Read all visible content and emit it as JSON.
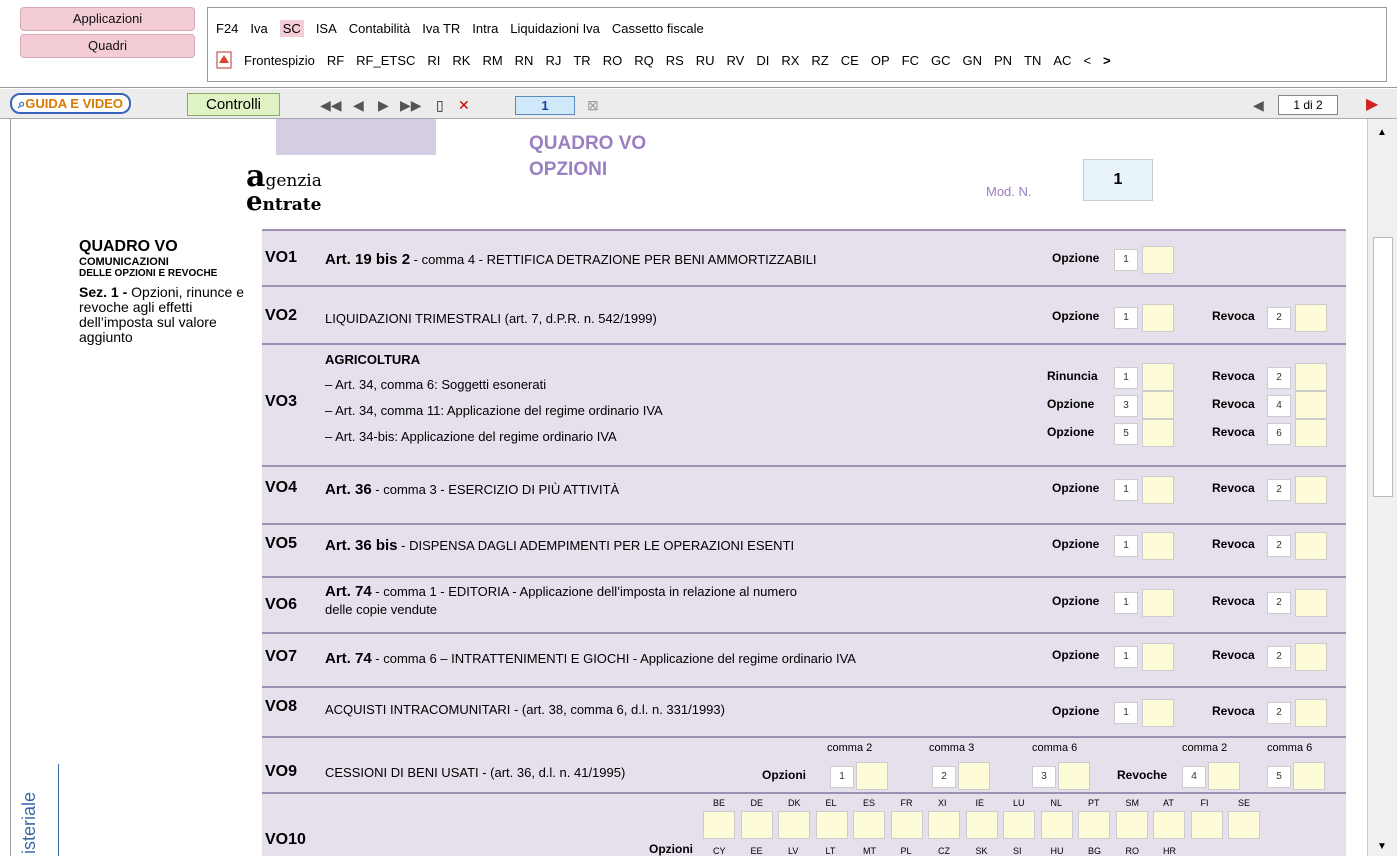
{
  "apps": {
    "applicazioni": "Applicazioni",
    "quadri": "Quadri"
  },
  "nav1": [
    "F24",
    "Iva",
    "SC",
    "ISA",
    "Contabilità",
    "Iva TR",
    "Intra",
    "Liquidazioni Iva",
    "Cassetto fiscale"
  ],
  "nav2": [
    "Frontespizio",
    "RF",
    "RF_ETSC",
    "RI",
    "RK",
    "RM",
    "RN",
    "RJ",
    "TR",
    "RO",
    "RQ",
    "RS",
    "RU",
    "RV",
    "DI",
    "RX",
    "RZ",
    "CE",
    "OP",
    "FC",
    "GC",
    "GN",
    "PN",
    "TN",
    "AC"
  ],
  "nav2_prev": "<",
  "nav2_next": ">",
  "toolbar": {
    "guida": "GUIDA E VIDEO",
    "controlli": "Controlli",
    "page": "1",
    "pagecount": "1 di 2"
  },
  "header": {
    "logo1": "genzia",
    "logo2": "ntrate",
    "title1": "QUADRO VO",
    "title2": "OPZIONI",
    "modn": "Mod. N.",
    "modval": "1"
  },
  "side": {
    "t1": "QUADRO VO",
    "t2": "Comunicazioni",
    "t3": "delle opzioni e revoche",
    "t4": "Sez. 1 -",
    "t5": "Opzioni, rinunce e revoche agli effetti dell’imposta sul valore aggiunto",
    "vert": "isteriale"
  },
  "rows": {
    "vo1": {
      "code": "VO1",
      "bold": "Art. 19 bis 2",
      "desc": " - comma 4 - RETTIFICA DETRAZIONE PER BENI AMMORTIZZABILI"
    },
    "vo2": {
      "code": "VO2",
      "desc": "LIQUIDAZIONI TRIMESTRALI  (art. 7, d.P.R. n. 542/1999)"
    },
    "vo3": {
      "code": "VO3",
      "head": "AGRICOLTURA",
      "l1": "– Art. 34, comma  6: Soggetti esonerati",
      "l2": "– Art. 34, comma 11: Applicazione del regime ordinario IVA",
      "l3": "– Art. 34-bis: Applicazione del regime ordinario IVA"
    },
    "vo4": {
      "code": "VO4",
      "bold": "Art. 36",
      "desc": " - comma 3 - ESERCIZIO DI PIÙ ATTIVITÀ"
    },
    "vo5": {
      "code": "VO5",
      "bold": "Art. 36 bis",
      "desc": " - DISPENSA DAGLI ADEMPIMENTI PER LE OPERAZIONI ESENTI"
    },
    "vo6": {
      "code": "VO6",
      "bold": "Art. 74",
      "desc": " - comma 1 - EDITORIA - Applicazione dell’imposta in relazione al numero",
      "desc2": "delle copie vendute"
    },
    "vo7": {
      "code": "VO7",
      "bold": "Art. 74",
      "desc": " - comma  6 – INTRATTENIMENTI E GIOCHI - Applicazione del regime ordinario IVA"
    },
    "vo8": {
      "code": "VO8",
      "desc": "ACQUISTI INTRACOMUNITARI - (art. 38, comma 6, d.l. n. 331/1993)"
    },
    "vo9": {
      "code": "VO9",
      "desc": "CESSIONI DI BENI USATI - (art. 36, d.l. n. 41/1995)"
    },
    "vo10": {
      "code": "VO10"
    }
  },
  "labels": {
    "opzione": "Opzione",
    "revoca": "Revoca",
    "rinuncia": "Rinuncia",
    "opzioni": "Opzioni",
    "revoche": "Revoche",
    "c2": "comma 2",
    "c3": "comma 3",
    "c6": "comma 6"
  },
  "nums": {
    "n1": "1",
    "n2": "2",
    "n3": "3",
    "n4": "4",
    "n5": "5",
    "n6": "6"
  },
  "countries": [
    "BE",
    "DE",
    "DK",
    "EL",
    "ES",
    "FR",
    "XI",
    "IE",
    "LU",
    "NL",
    "PT",
    "SM",
    "AT",
    "FI",
    "SE"
  ],
  "countries2": [
    "CY",
    "EE",
    "LV",
    "LT",
    "MT",
    "PL",
    "CZ",
    "SK",
    "SI",
    "HU",
    "BG",
    "RO",
    "HR"
  ]
}
